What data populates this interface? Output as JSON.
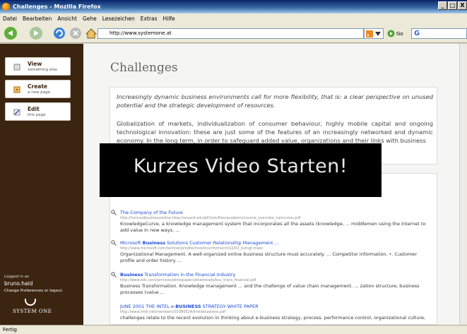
{
  "window": {
    "title": "Challenges - Mozilla Firefox",
    "buttons": [
      "_",
      "□",
      "X"
    ]
  },
  "menu": [
    "Datei",
    "Bearbeiten",
    "Ansicht",
    "Gehe",
    "Lesezeichen",
    "Extras",
    "Hilfe"
  ],
  "toolbar": {
    "url": "http://www.systemone.at",
    "go_label": "Go"
  },
  "sidebar": {
    "buttons": [
      {
        "label": "View",
        "sub": "something else"
      },
      {
        "label": "Create",
        "sub": "a new page"
      },
      {
        "label": "Edit",
        "sub": "this page"
      }
    ],
    "logged_in": "Logged in as",
    "username": "bruno.haid",
    "prefs": "Change Preferences or logout.",
    "logo": "SYSTEM ONE"
  },
  "page": {
    "title": "Challenges",
    "intro": "Increasingly dynamic business environments call for more flexibility, that is: a clear perspective on unused potential and the strategic development of resources.",
    "body": "Globalization of markets, individualization of consumer behaviour, highly mobile capital and ongoing technological innovation: these are just some of the features of an increasingly networked and dynamic economy. In the long term, in order to safeguard added value, organizations and their links with business"
  },
  "overlay": {
    "text": "Kurzes Video Starten!"
  },
  "results": [
    {
      "title_pre": "The Company of the Future",
      "title_bold": "",
      "title_post": "",
      "url": "http://harvardbusinessonline.hbsp.harvard.edu/b01/en/files/academic/course_overview_cairncross.pdf",
      "snippet": "KnowledgeCurve, a knowledge management system that incorporates all the assets (knowledge, ... middlemen using the Internet to add value in new ways. ..."
    },
    {
      "title_pre": "Microsoft ",
      "title_bold": "Business",
      "title_post": " Solutions Customer Relationship Management ...",
      "url": "http://www.microsoft.com/technet/prodtechnol/mscrm/mscrm12/03_bsmgt.mspx",
      "snippet": "Organizational Management. A well-organized online business structure must accurately. ... Competitor information. •. Customer profile and order history ..."
    },
    {
      "title_pre": "",
      "title_bold": "Business",
      "title_post": " Transformation in the Financial Industry",
      "url": "http://www.edc.com/services/whitepapers/downloads/bus_trans_financial.pdf",
      "snippet": "Business Transformation. Knowledge management ... and the challenge of value chain management. ... zation structure, business processes (value ..."
    },
    {
      "title_pre": "JUNE 2001 THE INTEL e-",
      "title_bold": "BUSINESS",
      "title_post": " STRATEGY WHITE PAPER",
      "url": "http://www.intel.net/members/01080524/intelebusiness.pdf",
      "snippet": "challenges relate to the recent evolution in thinking about e-business strategy, process. performance control, organizational culture,"
    }
  ],
  "status": "Fertig"
}
